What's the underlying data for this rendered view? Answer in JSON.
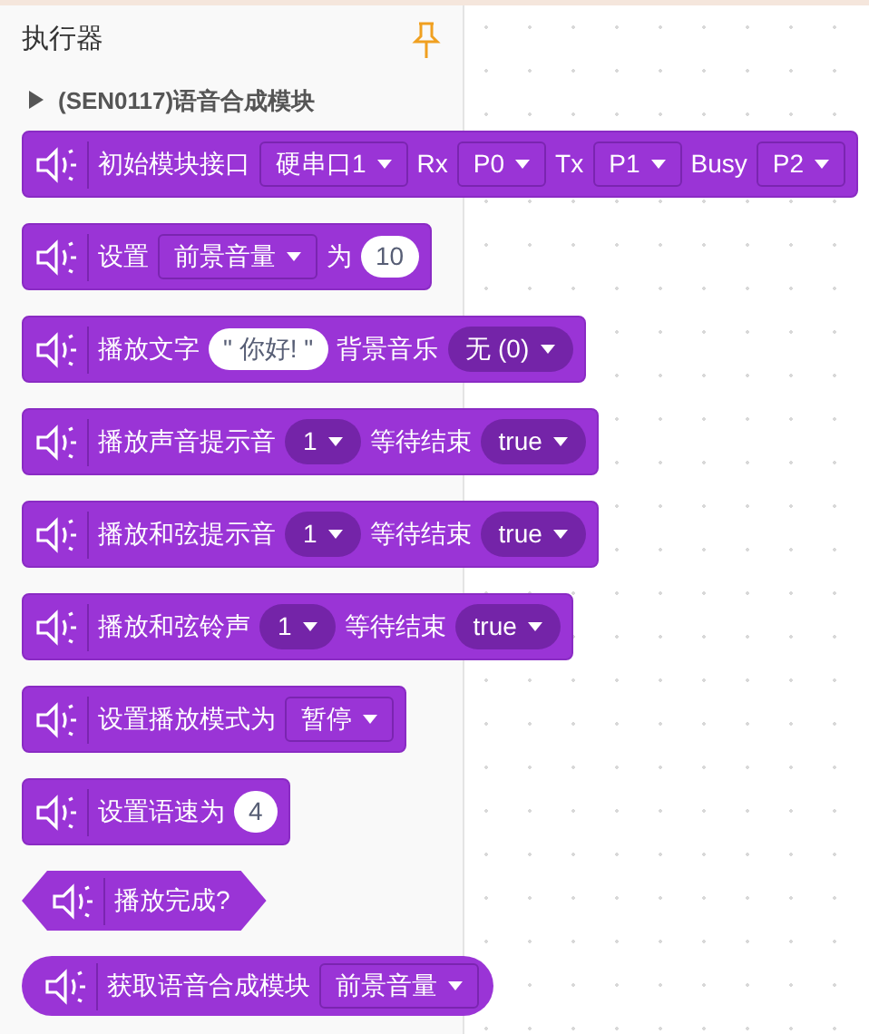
{
  "panel": {
    "title": "执行器",
    "category": {
      "label": "(SEN0117)语音合成模块",
      "expanded": false
    }
  },
  "blocks": [
    {
      "kind": "command",
      "parts": [
        {
          "kind": "text",
          "text": "初始模块接口"
        },
        {
          "kind": "dropdown",
          "text": "硬串口1"
        },
        {
          "kind": "text",
          "text": "Rx"
        },
        {
          "kind": "dropdown",
          "text": "P0"
        },
        {
          "kind": "text",
          "text": "Tx"
        },
        {
          "kind": "dropdown",
          "text": "P1"
        },
        {
          "kind": "text",
          "text": "Busy"
        },
        {
          "kind": "dropdown",
          "text": "P2"
        }
      ]
    },
    {
      "kind": "command",
      "parts": [
        {
          "kind": "text",
          "text": "设置"
        },
        {
          "kind": "dropdown",
          "text": "前景音量"
        },
        {
          "kind": "text",
          "text": "为"
        },
        {
          "kind": "number",
          "text": "10"
        }
      ]
    },
    {
      "kind": "command",
      "parts": [
        {
          "kind": "text",
          "text": "播放文字"
        },
        {
          "kind": "string",
          "text": "\" 你好! \""
        },
        {
          "kind": "text",
          "text": "背景音乐"
        },
        {
          "kind": "pill",
          "text": "无 (0)"
        }
      ]
    },
    {
      "kind": "command",
      "parts": [
        {
          "kind": "text",
          "text": "播放声音提示音"
        },
        {
          "kind": "pill",
          "text": "1"
        },
        {
          "kind": "text",
          "text": "等待结束"
        },
        {
          "kind": "pill",
          "text": "true"
        }
      ]
    },
    {
      "kind": "command",
      "parts": [
        {
          "kind": "text",
          "text": "播放和弦提示音"
        },
        {
          "kind": "pill",
          "text": "1"
        },
        {
          "kind": "text",
          "text": "等待结束"
        },
        {
          "kind": "pill",
          "text": "true"
        }
      ]
    },
    {
      "kind": "command",
      "parts": [
        {
          "kind": "text",
          "text": "播放和弦铃声"
        },
        {
          "kind": "pill",
          "text": "1"
        },
        {
          "kind": "text",
          "text": "等待结束"
        },
        {
          "kind": "pill",
          "text": "true"
        }
      ]
    },
    {
      "kind": "command",
      "parts": [
        {
          "kind": "text",
          "text": "设置播放模式为"
        },
        {
          "kind": "dropdown",
          "text": "暂停"
        }
      ]
    },
    {
      "kind": "command",
      "parts": [
        {
          "kind": "text",
          "text": "设置语速为"
        },
        {
          "kind": "number",
          "text": "4"
        }
      ]
    },
    {
      "kind": "boolean",
      "parts": [
        {
          "kind": "text",
          "text": "播放完成?"
        }
      ]
    },
    {
      "kind": "reporter",
      "parts": [
        {
          "kind": "text",
          "text": "获取语音合成模块"
        },
        {
          "kind": "dropdown",
          "text": "前景音量"
        }
      ]
    }
  ]
}
